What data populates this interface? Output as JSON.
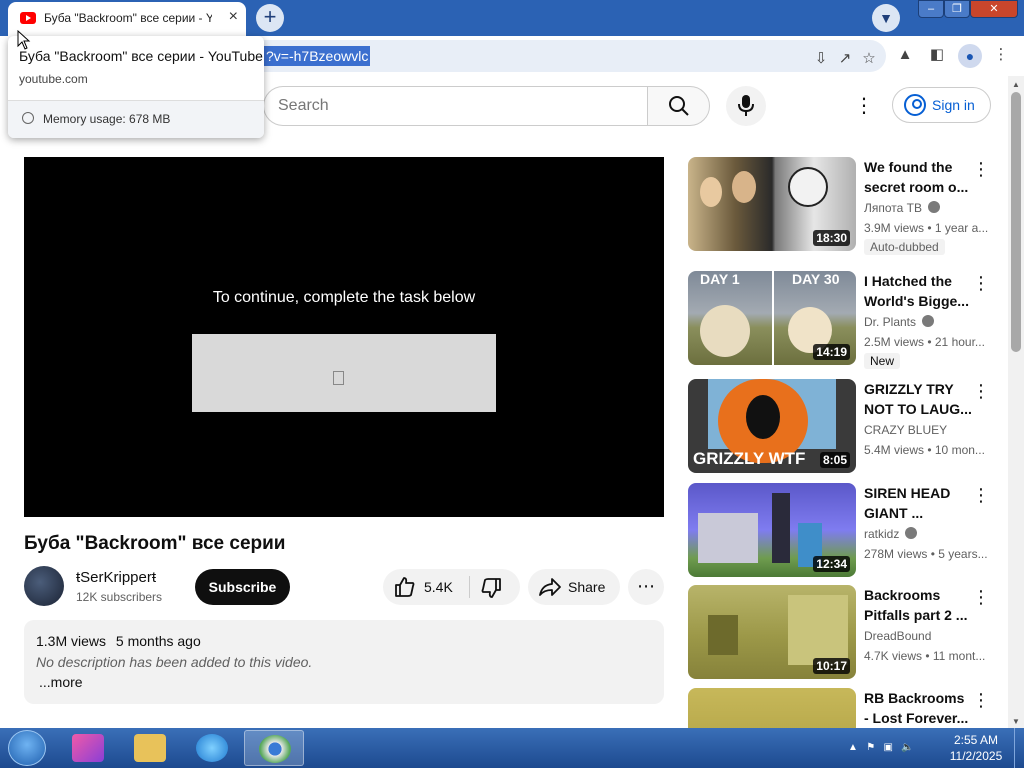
{
  "browser": {
    "tab_title": "Буба \"Backroom\" все серии - YouTube",
    "tab_close": "×",
    "new_tab": "+",
    "url_selected": "?v=-h7Bzeowvlc",
    "tooltip": {
      "title": "Буба \"Backroom\" все серии - YouTube",
      "domain": "youtube.com",
      "memory": "Memory usage: 678 MB"
    }
  },
  "header": {
    "search_placeholder": "Search",
    "signin_label": "Sign in"
  },
  "player": {
    "message": "To continue, complete the task below"
  },
  "video": {
    "title": "Буба \"Backroom\" все серии",
    "channel": "ŧSerKripperŧ",
    "subscribers": "12K subscribers",
    "subscribe_label": "Subscribe",
    "likes": "5.4K",
    "share_label": "Share",
    "views": "1.3M views",
    "age": "5 months ago",
    "description": "No description has been added to this video.",
    "more_label": "...more"
  },
  "recommendations": [
    {
      "title_line1": "We found the",
      "title_line2": "secret room o...",
      "channel": "Ляпота ТВ",
      "meta": "3.9M views • 1 year a...",
      "duration": "18:30",
      "badge": "Auto-dubbed"
    },
    {
      "title_line1": "I Hatched the",
      "title_line2": "World's Bigge...",
      "channel": "Dr. Plants",
      "meta": "2.5M views • 21 hour...",
      "duration": "14:19",
      "badge": "New"
    },
    {
      "title_line1": "GRIZZLY TRY",
      "title_line2": "NOT TO LAUG...",
      "channel": "CRAZY BLUEY",
      "meta": "5.4M views • 10 mon...",
      "duration": "8:05",
      "badge": ""
    },
    {
      "title_line1": "SIREN HEAD",
      "title_line2": "GIANT ...",
      "channel": "ratkidz",
      "meta": "278M views • 5 years...",
      "duration": "12:34",
      "badge": ""
    },
    {
      "title_line1": "Backrooms",
      "title_line2": "Pitfalls part 2 ...",
      "channel": "DreadBound",
      "meta": "4.7K views • 11 mont...",
      "duration": "10:17",
      "badge": ""
    },
    {
      "title_line1": "RB Backrooms",
      "title_line2": "- Lost Forever...",
      "channel": "",
      "meta": "",
      "duration": "",
      "badge": ""
    }
  ],
  "thumb_texts": {
    "day1": "DAY 1",
    "day30": "DAY 30",
    "grizzly": "GRIZZLY WTF"
  },
  "taskbar": {
    "time": "2:55 AM",
    "date": "11/2/2025"
  }
}
